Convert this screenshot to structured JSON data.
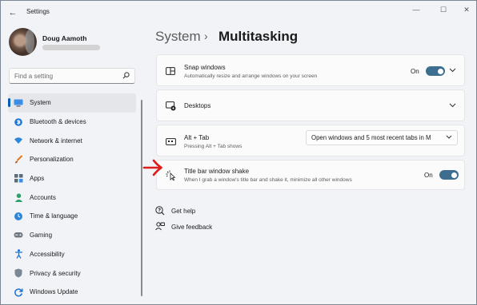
{
  "window": {
    "title": "Settings",
    "back_glyph": "←",
    "controls": {
      "minimize": "—",
      "maximize": "☐",
      "close": "✕"
    }
  },
  "profile": {
    "name": "Doug Aamoth"
  },
  "search": {
    "placeholder": "Find a setting",
    "icon": "search-icon"
  },
  "nav": {
    "items": [
      {
        "label": "System",
        "icon": "🖥",
        "active": true
      },
      {
        "label": "Bluetooth & devices",
        "icon": "✱"
      },
      {
        "label": "Network & internet",
        "icon": "◆"
      },
      {
        "label": "Personalization",
        "icon": "✎"
      },
      {
        "label": "Apps",
        "icon": "▦"
      },
      {
        "label": "Accounts",
        "icon": "●"
      },
      {
        "label": "Time & language",
        "icon": "◷"
      },
      {
        "label": "Gaming",
        "icon": "◉"
      },
      {
        "label": "Accessibility",
        "icon": "✦"
      },
      {
        "label": "Privacy & security",
        "icon": "⛨"
      },
      {
        "label": "Windows Update",
        "icon": "⟳"
      }
    ]
  },
  "header": {
    "root": "System",
    "separator": "›",
    "page": "Multitasking"
  },
  "settings": {
    "snap": {
      "title": "Snap windows",
      "subtitle": "Automatically resize and arrange windows on your screen",
      "toggle_label": "On",
      "toggle_on": true
    },
    "desktops": {
      "title": "Desktops"
    },
    "alt_tab": {
      "title": "Alt + Tab",
      "subtitle": "Pressing Alt + Tab shows",
      "selected": "Open windows and 5 most recent tabs in M"
    },
    "shake": {
      "title": "Title bar window shake",
      "subtitle": "When I grab a window's title bar and shake it, minimize all other windows",
      "toggle_label": "On",
      "toggle_on": true
    }
  },
  "links": {
    "help": "Get help",
    "feedback": "Give feedback"
  },
  "colors": {
    "accent": "#005fb8",
    "toggle_on": "#3d6e90",
    "annotation": "#e01b1b"
  }
}
